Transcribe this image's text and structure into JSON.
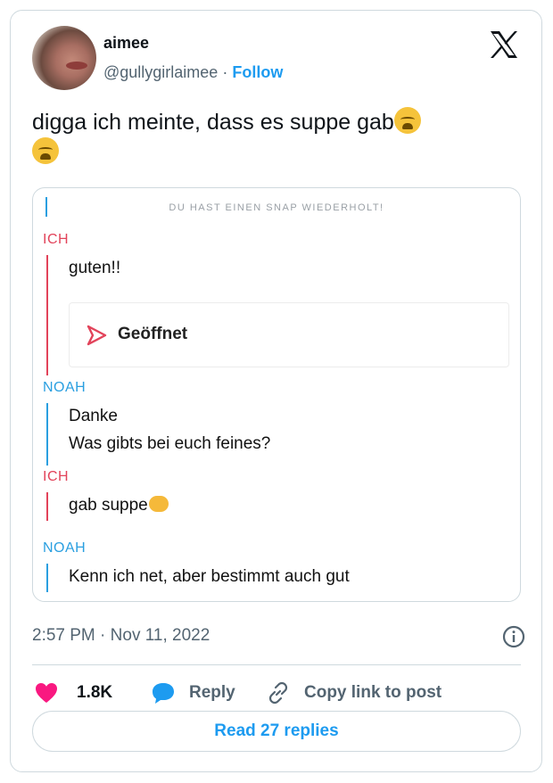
{
  "author": {
    "name": "aimee",
    "handle": "@gullygirlaimee",
    "separator": "·",
    "follow_label": "Follow"
  },
  "tweet": {
    "text": "digga ich meinte, dass es suppe gab"
  },
  "snap": {
    "header": "DU HAST EINEN SNAP WIEDERHOLT!",
    "groups": [
      {
        "sender": "ICH",
        "lines": [
          "guten!!"
        ],
        "opened_label": "Geöffnet"
      },
      {
        "sender": "NOAH",
        "lines": [
          "Danke",
          "Was gibts bei euch feines?"
        ]
      },
      {
        "sender": "ICH",
        "lines": [
          "gab suppe"
        ]
      },
      {
        "sender": "NOAH",
        "lines": [
          "Kenn ich net, aber bestimmt auch gut"
        ]
      }
    ]
  },
  "meta": {
    "time": "2:57 PM",
    "separator": "·",
    "date": "Nov 11, 2022"
  },
  "actions": {
    "likes": "1.8K",
    "reply": "Reply",
    "copy": "Copy link to post"
  },
  "read_replies": "Read 27 replies",
  "icons": {
    "logo": "x-logo-icon",
    "info": "info-icon",
    "like": "heart-icon",
    "reply": "speech-bubble-icon",
    "copy": "link-icon",
    "opened": "opened-arrow-icon",
    "emoji": "loudly-crying-face-icon"
  },
  "colors": {
    "accent": "#1d9bf0",
    "like": "#f91880",
    "me": "#e2435a",
    "noah": "#2a9fe0"
  }
}
